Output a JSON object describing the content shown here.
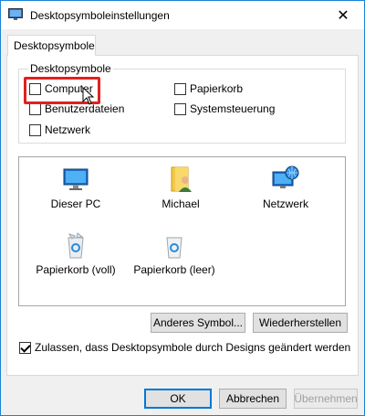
{
  "window": {
    "title": "Desktopsymboleinstellungen"
  },
  "tab": {
    "label": "Desktopsymbole"
  },
  "group": {
    "label": "Desktopsymbole",
    "checkboxes": [
      {
        "label": "Computer",
        "checked": false
      },
      {
        "label": "Benutzerdateien",
        "checked": false
      },
      {
        "label": "Netzwerk",
        "checked": false
      },
      {
        "label": "Papierkorb",
        "checked": false
      },
      {
        "label": "Systemsteuerung",
        "checked": false
      }
    ]
  },
  "icons": [
    {
      "label": "Dieser PC",
      "icon": "monitor-icon"
    },
    {
      "label": "Michael",
      "icon": "user-folder-icon"
    },
    {
      "label": "Netzwerk",
      "icon": "network-icon"
    },
    {
      "label": "Papierkorb (voll)",
      "icon": "recycle-bin-full-icon"
    },
    {
      "label": "Papierkorb (leer)",
      "icon": "recycle-bin-empty-icon"
    }
  ],
  "buttons": {
    "change_icon": "Anderes Symbol...",
    "restore": "Wiederherstellen",
    "ok": "OK",
    "cancel": "Abbrechen",
    "apply": "Übernehmen"
  },
  "allow_themes": {
    "label": "Zulassen, dass Desktopsymbole durch Designs geändert werden",
    "checked": true
  },
  "colors": {
    "accent": "#0078d7",
    "highlight": "#e0211e"
  }
}
